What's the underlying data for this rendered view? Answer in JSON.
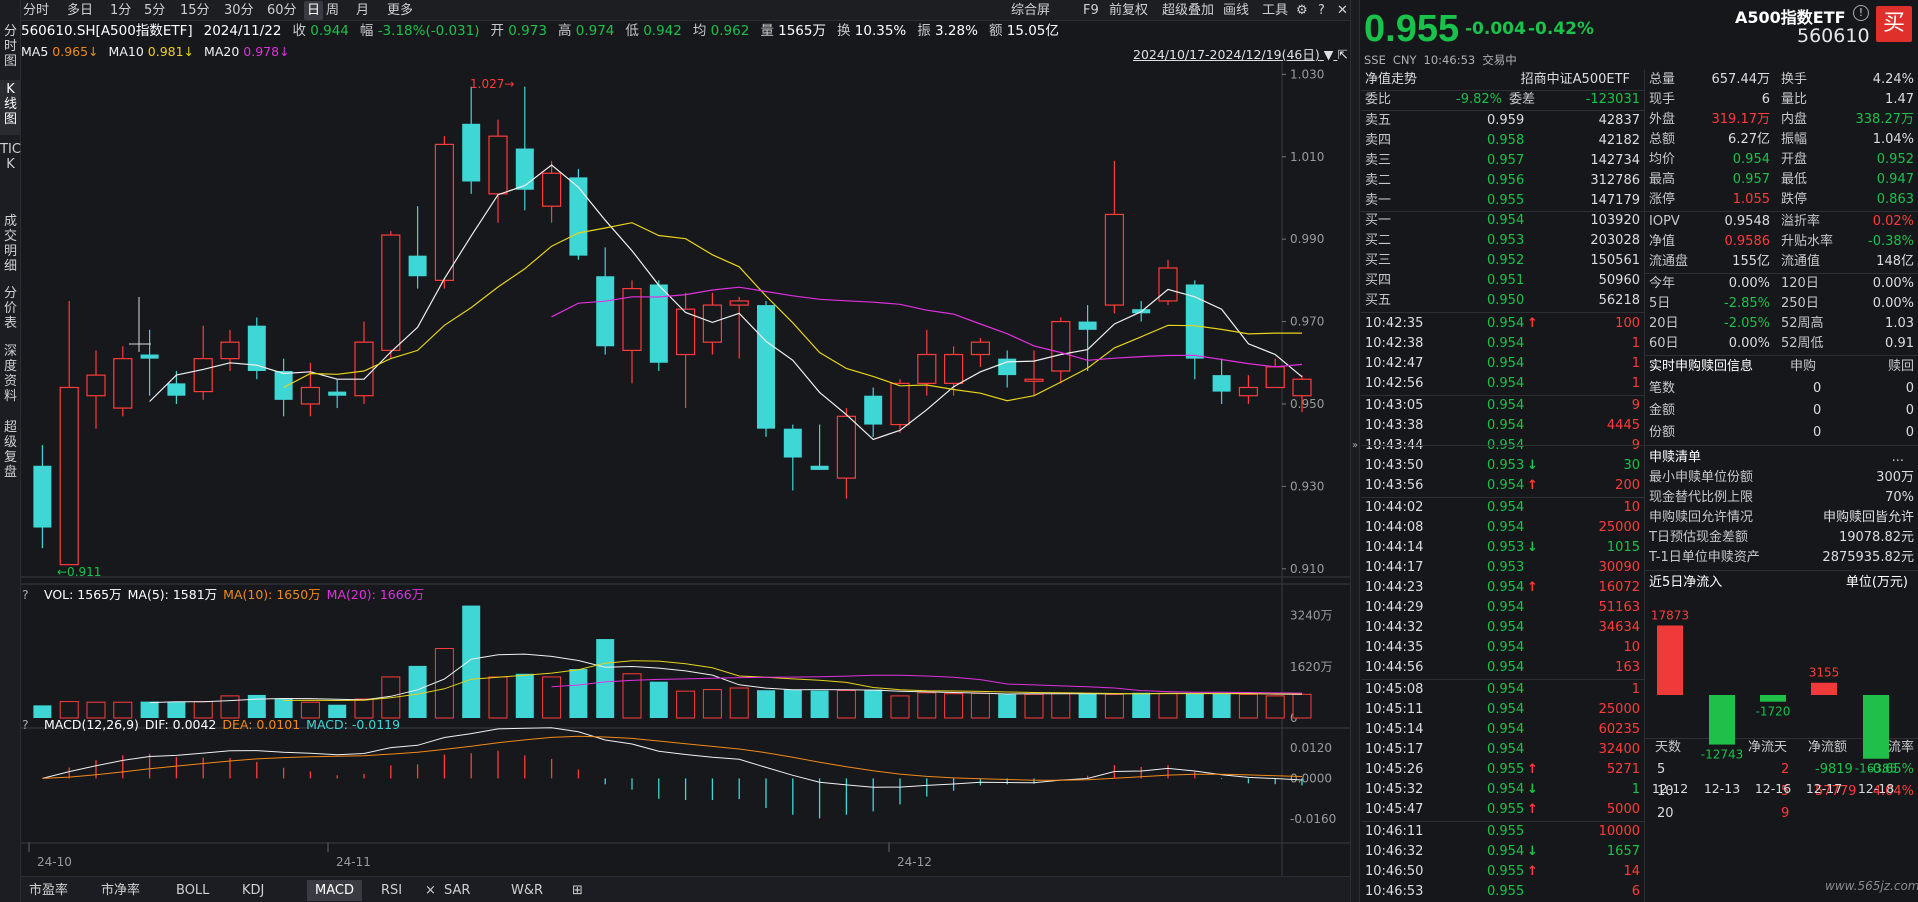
{
  "side_tabs": [
    "分时图",
    "K线图",
    "TICK",
    "成交明细",
    "分价表",
    "深度资料",
    "超级复盘"
  ],
  "periods": [
    "分时",
    "多日",
    "1分",
    "5分",
    "15分",
    "30分",
    "60分",
    "日",
    "周",
    "月",
    "更多"
  ],
  "active_period": "日",
  "tools": [
    "综合屏",
    "F9",
    "前复权",
    "超级叠加",
    "画线",
    "工具"
  ],
  "quote": {
    "code": "560610.SH[A500指数ETF]",
    "date": "2024/11/22",
    "close_label": "收",
    "close": "0.944",
    "range_label": "幅",
    "range": "-3.18%(-0.031)",
    "open_label": "开",
    "open": "0.973",
    "high_label": "高",
    "high": "0.974",
    "low_label": "低",
    "low": "0.942",
    "avg_label": "均",
    "avg": "0.962",
    "vol_label": "量",
    "vol": "1565万",
    "turn_label": "换",
    "turn": "10.35%",
    "amp_label": "振",
    "amp": "3.28%",
    "amt_label": "额",
    "amt": "15.05亿"
  },
  "ma": {
    "ma5": "MA5",
    "ma5_val": "0.965↓",
    "ma10": "MA10",
    "ma10_val": "0.981↓",
    "ma20": "MA20",
    "ma20_val": "0.978↓"
  },
  "date_range": "2024/10/17-2024/12/19(46日)",
  "chart_data": {
    "type": "candlestick",
    "y_ticks": [
      "1.030",
      "1.010",
      "0.990",
      "0.970",
      "0.950",
      "0.930",
      "0.910"
    ],
    "ylim": [
      0.908,
      1.033
    ],
    "x_labels": [
      "24-10",
      "24-11",
      "24-12"
    ],
    "annotations": {
      "max": "1.027",
      "min": "0.911"
    },
    "candles": [
      {
        "o": 0.935,
        "c": 0.92,
        "h": 0.94,
        "l": 0.915
      },
      {
        "o": 0.911,
        "c": 0.954,
        "h": 0.975,
        "l": 0.911
      },
      {
        "o": 0.952,
        "c": 0.957,
        "h": 0.963,
        "l": 0.944
      },
      {
        "o": 0.949,
        "c": 0.961,
        "h": 0.964,
        "l": 0.947
      },
      {
        "o": 0.962,
        "c": 0.961,
        "h": 0.968,
        "l": 0.952
      },
      {
        "o": 0.955,
        "c": 0.952,
        "h": 0.958,
        "l": 0.95
      },
      {
        "o": 0.953,
        "c": 0.961,
        "h": 0.969,
        "l": 0.951
      },
      {
        "o": 0.961,
        "c": 0.965,
        "h": 0.968,
        "l": 0.958
      },
      {
        "o": 0.969,
        "c": 0.958,
        "h": 0.971,
        "l": 0.956
      },
      {
        "o": 0.958,
        "c": 0.951,
        "h": 0.961,
        "l": 0.947
      },
      {
        "o": 0.95,
        "c": 0.954,
        "h": 0.96,
        "l": 0.947
      },
      {
        "o": 0.953,
        "c": 0.952,
        "h": 0.956,
        "l": 0.949
      },
      {
        "o": 0.952,
        "c": 0.965,
        "h": 0.97,
        "l": 0.95
      },
      {
        "o": 0.963,
        "c": 0.991,
        "h": 0.992,
        "l": 0.961
      },
      {
        "o": 0.986,
        "c": 0.981,
        "h": 0.998,
        "l": 0.978
      },
      {
        "o": 0.98,
        "c": 1.013,
        "h": 1.015,
        "l": 0.978
      },
      {
        "o": 1.018,
        "c": 1.004,
        "h": 1.027,
        "l": 1.001
      },
      {
        "o": 1.001,
        "c": 1.015,
        "h": 1.019,
        "l": 0.994
      },
      {
        "o": 1.012,
        "c": 1.002,
        "h": 1.027,
        "l": 0.997
      },
      {
        "o": 0.998,
        "c": 1.006,
        "h": 1.009,
        "l": 0.994
      },
      {
        "o": 1.005,
        "c": 0.986,
        "h": 1.007,
        "l": 0.985
      },
      {
        "o": 0.981,
        "c": 0.964,
        "h": 0.988,
        "l": 0.962
      },
      {
        "o": 0.963,
        "c": 0.978,
        "h": 0.98,
        "l": 0.955
      },
      {
        "o": 0.979,
        "c": 0.96,
        "h": 0.98,
        "l": 0.958
      },
      {
        "o": 0.962,
        "c": 0.973,
        "h": 0.977,
        "l": 0.949
      },
      {
        "o": 0.965,
        "c": 0.974,
        "h": 0.977,
        "l": 0.962
      },
      {
        "o": 0.974,
        "c": 0.975,
        "h": 0.976,
        "l": 0.961
      },
      {
        "o": 0.974,
        "c": 0.944,
        "h": 0.975,
        "l": 0.942
      },
      {
        "o": 0.944,
        "c": 0.937,
        "h": 0.945,
        "l": 0.929
      },
      {
        "o": 0.935,
        "c": 0.934,
        "h": 0.945,
        "l": 0.934
      },
      {
        "o": 0.932,
        "c": 0.947,
        "h": 0.949,
        "l": 0.927
      },
      {
        "o": 0.952,
        "c": 0.945,
        "h": 0.954,
        "l": 0.942
      },
      {
        "o": 0.945,
        "c": 0.955,
        "h": 0.956,
        "l": 0.943
      },
      {
        "o": 0.955,
        "c": 0.962,
        "h": 0.968,
        "l": 0.952
      },
      {
        "o": 0.955,
        "c": 0.962,
        "h": 0.964,
        "l": 0.952
      },
      {
        "o": 0.962,
        "c": 0.965,
        "h": 0.966,
        "l": 0.959
      },
      {
        "o": 0.961,
        "c": 0.957,
        "h": 0.963,
        "l": 0.954
      },
      {
        "o": 0.956,
        "c": 0.956,
        "h": 0.963,
        "l": 0.952
      },
      {
        "o": 0.958,
        "c": 0.97,
        "h": 0.971,
        "l": 0.955
      },
      {
        "o": 0.97,
        "c": 0.968,
        "h": 0.974,
        "l": 0.958
      },
      {
        "o": 0.974,
        "c": 0.996,
        "h": 1.009,
        "l": 0.972
      },
      {
        "o": 0.973,
        "c": 0.972,
        "h": 0.975,
        "l": 0.97
      },
      {
        "o": 0.975,
        "c": 0.983,
        "h": 0.985,
        "l": 0.974
      },
      {
        "o": 0.979,
        "c": 0.961,
        "h": 0.98,
        "l": 0.956
      },
      {
        "o": 0.957,
        "c": 0.953,
        "h": 0.961,
        "l": 0.95
      },
      {
        "o": 0.952,
        "c": 0.954,
        "h": 0.957,
        "l": 0.95
      },
      {
        "o": 0.954,
        "c": 0.959,
        "h": 0.961,
        "l": 0.954
      },
      {
        "o": 0.952,
        "c": 0.956,
        "h": 0.957,
        "l": 0.948
      }
    ],
    "vol_ticks": [
      "3240万",
      "1620万",
      "0"
    ],
    "volumes": [
      400,
      520,
      500,
      500,
      520,
      520,
      520,
      700,
      730,
      620,
      500,
      420,
      600,
      1300,
      1650,
      2200,
      3560,
      1300,
      1400,
      1300,
      1550,
      2500,
      1400,
      1150,
      850,
      900,
      950,
      880,
      900,
      870,
      870,
      900,
      700,
      800,
      770,
      780,
      750,
      750,
      780,
      780,
      750,
      800,
      780,
      780,
      780,
      750,
      700,
      750,
      700,
      720,
      720,
      600,
      570
    ],
    "macd_ticks": [
      "0.0120",
      "0.0000",
      "-0.0160"
    ],
    "macd": {
      "dif": "0.0042",
      "dea": "0.0101",
      "macd": "-0.0119"
    }
  },
  "vol_label": {
    "vol": "VOL: 1565万",
    "ma5": "MA(5): 1581万",
    "ma10": "MA(10): 1650万",
    "ma20": "MA(20): 1666万"
  },
  "macd_label": {
    "title": "MACD(12,26,9)",
    "dif": "DIF: 0.0042",
    "dea": "DEA: 0.0101",
    "macd": "MACD: -0.0119"
  },
  "bottom_tabs": [
    "市盈率",
    "市净率",
    "BOLL",
    "KDJ",
    "MACD",
    "RSI",
    "SAR",
    "W&R"
  ],
  "active_bottom": "MACD",
  "right": {
    "price": "0.955",
    "chg": "-0.004",
    "chg_pct": "-0.42%",
    "name": "A500指数ETF",
    "code": "560610",
    "buy": "买",
    "exch": "SSE",
    "cur": "CNY",
    "time": "10:46:53",
    "status": "交易中",
    "nav_title": "净值走势",
    "index_name": "招商中证A500ETF",
    "wb_label": "委比",
    "wb": "-9.82%",
    "wc_label": "委差",
    "wc": "-123031",
    "asks": [
      [
        "卖五",
        "0.959",
        "42837"
      ],
      [
        "卖四",
        "0.958",
        "42182"
      ],
      [
        "卖三",
        "0.957",
        "142734"
      ],
      [
        "卖二",
        "0.956",
        "312786"
      ],
      [
        "卖一",
        "0.955",
        "147179"
      ]
    ],
    "bids": [
      [
        "买一",
        "0.954",
        "103920"
      ],
      [
        "买二",
        "0.953",
        "203028"
      ],
      [
        "买三",
        "0.952",
        "150561"
      ],
      [
        "买四",
        "0.951",
        "50960"
      ],
      [
        "买五",
        "0.950",
        "56218"
      ]
    ],
    "ticks": [
      [
        "10:42:35",
        "0.954",
        "↑",
        "100"
      ],
      [
        "10:42:38",
        "0.954",
        "",
        "1"
      ],
      [
        "10:42:47",
        "0.954",
        "",
        "1"
      ],
      [
        "10:42:56",
        "0.954",
        "",
        "1"
      ],
      [
        "10:43:05",
        "0.954",
        "",
        "9"
      ],
      [
        "10:43:38",
        "0.954",
        "",
        "4445"
      ],
      [
        "10:43:44",
        "0.954",
        "",
        "9"
      ],
      [
        "10:43:50",
        "0.953",
        "↓",
        "30"
      ],
      [
        "10:43:56",
        "0.954",
        "↑",
        "200"
      ],
      [
        "10:44:02",
        "0.954",
        "",
        "10"
      ],
      [
        "10:44:08",
        "0.954",
        "",
        "25000"
      ],
      [
        "10:44:14",
        "0.953",
        "↓",
        "1015"
      ],
      [
        "10:44:17",
        "0.953",
        "",
        "30090"
      ],
      [
        "10:44:23",
        "0.954",
        "↑",
        "16072"
      ],
      [
        "10:44:29",
        "0.954",
        "",
        "51163"
      ],
      [
        "10:44:32",
        "0.954",
        "",
        "34634"
      ],
      [
        "10:44:35",
        "0.954",
        "",
        "10"
      ],
      [
        "10:44:56",
        "0.954",
        "",
        "163"
      ],
      [
        "10:45:08",
        "0.954",
        "",
        "1"
      ],
      [
        "10:45:11",
        "0.954",
        "",
        "25000"
      ],
      [
        "10:45:14",
        "0.954",
        "",
        "60235"
      ],
      [
        "10:45:17",
        "0.954",
        "",
        "32400"
      ],
      [
        "10:45:26",
        "0.955",
        "↑",
        "5271"
      ],
      [
        "10:45:32",
        "0.954",
        "↓",
        "1"
      ],
      [
        "10:45:47",
        "0.955",
        "↑",
        "5000"
      ],
      [
        "10:46:11",
        "0.955",
        "",
        "10000"
      ],
      [
        "10:46:32",
        "0.954",
        "↓",
        "1657"
      ],
      [
        "10:46:50",
        "0.955",
        "↑",
        "14"
      ],
      [
        "10:46:53",
        "0.955",
        "",
        "6"
      ]
    ],
    "stats": [
      [
        "总量",
        "657.44万",
        "换手",
        "4.24%"
      ],
      [
        "现手",
        "6",
        "量比",
        "1.47"
      ],
      [
        "外盘",
        "319.17万",
        "内盘",
        "338.27万"
      ],
      [
        "总额",
        "6.27亿",
        "振幅",
        "1.04%"
      ],
      [
        "均价",
        "0.954",
        "开盘",
        "0.952"
      ],
      [
        "最高",
        "0.957",
        "最低",
        "0.947"
      ],
      [
        "涨停",
        "1.055",
        "跌停",
        "0.863"
      ],
      [
        "IOPV",
        "0.9548",
        "溢折率",
        "0.02%"
      ],
      [
        "净值",
        "0.9586",
        "升贴水率",
        "-0.38%"
      ],
      [
        "流通盘",
        "155亿",
        "流通值",
        "148亿"
      ],
      [
        "今年",
        "0.00%",
        "120日",
        "0.00%"
      ],
      [
        "5日",
        "-2.85%",
        "250日",
        "0.00%"
      ],
      [
        "20日",
        "-2.05%",
        "52周高",
        "1.03"
      ],
      [
        "60日",
        "0.00%",
        "52周低",
        "0.91"
      ]
    ],
    "redeem_title": "实时申购赎回信息",
    "redeem_h1": "申购",
    "redeem_h2": "赎回",
    "redeem_rows": [
      [
        "笔数",
        "0",
        "0"
      ],
      [
        "金额",
        "0",
        "0"
      ],
      [
        "份额",
        "0",
        "0"
      ]
    ],
    "list_title": "申赎清单",
    "list_more": "...",
    "list_rows": [
      [
        "最小申赎单位份额",
        "300万"
      ],
      [
        "现金替代比例上限",
        "70%"
      ],
      [
        "申购赎回允许情况",
        "申购赎回皆允许"
      ],
      [
        "T日预估现金差额",
        "19078.82元"
      ],
      [
        "T-1日单位申赎资产",
        "2875935.82元"
      ]
    ],
    "flow_title": "近5日净流入",
    "flow_unit": "单位(万元)",
    "flow_dates": [
      "12-12",
      "12-13",
      "12-16",
      "12-17",
      "12-18"
    ],
    "flow_values": [
      17873,
      -12743,
      -1720,
      3155,
      -16385
    ],
    "flow_table_head": [
      "天数",
      "净流天",
      "净流额",
      "净流率"
    ],
    "flow_table": [
      [
        "5",
        "2",
        "-9819",
        "-0.65%"
      ],
      [
        "10",
        "5",
        "57779",
        "4.04%"
      ],
      [
        "20",
        "9",
        "",
        ""
      ]
    ]
  },
  "watermark": "www.565jz.com",
  "colors": {
    "up": "#ff3b3b",
    "down": "#3fd6d6",
    "ma5": "#f0f0f0",
    "ma10": "#e6d21a",
    "ma20": "#e030e0"
  }
}
